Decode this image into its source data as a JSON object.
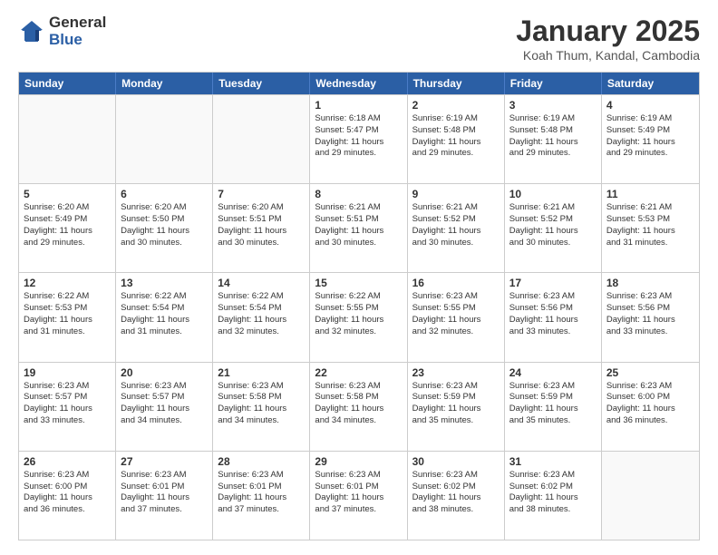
{
  "header": {
    "logo_general": "General",
    "logo_blue": "Blue",
    "month_title": "January 2025",
    "location": "Koah Thum, Kandal, Cambodia"
  },
  "days_of_week": [
    "Sunday",
    "Monday",
    "Tuesday",
    "Wednesday",
    "Thursday",
    "Friday",
    "Saturday"
  ],
  "weeks": [
    [
      {
        "day": "",
        "info": ""
      },
      {
        "day": "",
        "info": ""
      },
      {
        "day": "",
        "info": ""
      },
      {
        "day": "1",
        "info": "Sunrise: 6:18 AM\nSunset: 5:47 PM\nDaylight: 11 hours\nand 29 minutes."
      },
      {
        "day": "2",
        "info": "Sunrise: 6:19 AM\nSunset: 5:48 PM\nDaylight: 11 hours\nand 29 minutes."
      },
      {
        "day": "3",
        "info": "Sunrise: 6:19 AM\nSunset: 5:48 PM\nDaylight: 11 hours\nand 29 minutes."
      },
      {
        "day": "4",
        "info": "Sunrise: 6:19 AM\nSunset: 5:49 PM\nDaylight: 11 hours\nand 29 minutes."
      }
    ],
    [
      {
        "day": "5",
        "info": "Sunrise: 6:20 AM\nSunset: 5:49 PM\nDaylight: 11 hours\nand 29 minutes."
      },
      {
        "day": "6",
        "info": "Sunrise: 6:20 AM\nSunset: 5:50 PM\nDaylight: 11 hours\nand 30 minutes."
      },
      {
        "day": "7",
        "info": "Sunrise: 6:20 AM\nSunset: 5:51 PM\nDaylight: 11 hours\nand 30 minutes."
      },
      {
        "day": "8",
        "info": "Sunrise: 6:21 AM\nSunset: 5:51 PM\nDaylight: 11 hours\nand 30 minutes."
      },
      {
        "day": "9",
        "info": "Sunrise: 6:21 AM\nSunset: 5:52 PM\nDaylight: 11 hours\nand 30 minutes."
      },
      {
        "day": "10",
        "info": "Sunrise: 6:21 AM\nSunset: 5:52 PM\nDaylight: 11 hours\nand 30 minutes."
      },
      {
        "day": "11",
        "info": "Sunrise: 6:21 AM\nSunset: 5:53 PM\nDaylight: 11 hours\nand 31 minutes."
      }
    ],
    [
      {
        "day": "12",
        "info": "Sunrise: 6:22 AM\nSunset: 5:53 PM\nDaylight: 11 hours\nand 31 minutes."
      },
      {
        "day": "13",
        "info": "Sunrise: 6:22 AM\nSunset: 5:54 PM\nDaylight: 11 hours\nand 31 minutes."
      },
      {
        "day": "14",
        "info": "Sunrise: 6:22 AM\nSunset: 5:54 PM\nDaylight: 11 hours\nand 32 minutes."
      },
      {
        "day": "15",
        "info": "Sunrise: 6:22 AM\nSunset: 5:55 PM\nDaylight: 11 hours\nand 32 minutes."
      },
      {
        "day": "16",
        "info": "Sunrise: 6:23 AM\nSunset: 5:55 PM\nDaylight: 11 hours\nand 32 minutes."
      },
      {
        "day": "17",
        "info": "Sunrise: 6:23 AM\nSunset: 5:56 PM\nDaylight: 11 hours\nand 33 minutes."
      },
      {
        "day": "18",
        "info": "Sunrise: 6:23 AM\nSunset: 5:56 PM\nDaylight: 11 hours\nand 33 minutes."
      }
    ],
    [
      {
        "day": "19",
        "info": "Sunrise: 6:23 AM\nSunset: 5:57 PM\nDaylight: 11 hours\nand 33 minutes."
      },
      {
        "day": "20",
        "info": "Sunrise: 6:23 AM\nSunset: 5:57 PM\nDaylight: 11 hours\nand 34 minutes."
      },
      {
        "day": "21",
        "info": "Sunrise: 6:23 AM\nSunset: 5:58 PM\nDaylight: 11 hours\nand 34 minutes."
      },
      {
        "day": "22",
        "info": "Sunrise: 6:23 AM\nSunset: 5:58 PM\nDaylight: 11 hours\nand 34 minutes."
      },
      {
        "day": "23",
        "info": "Sunrise: 6:23 AM\nSunset: 5:59 PM\nDaylight: 11 hours\nand 35 minutes."
      },
      {
        "day": "24",
        "info": "Sunrise: 6:23 AM\nSunset: 5:59 PM\nDaylight: 11 hours\nand 35 minutes."
      },
      {
        "day": "25",
        "info": "Sunrise: 6:23 AM\nSunset: 6:00 PM\nDaylight: 11 hours\nand 36 minutes."
      }
    ],
    [
      {
        "day": "26",
        "info": "Sunrise: 6:23 AM\nSunset: 6:00 PM\nDaylight: 11 hours\nand 36 minutes."
      },
      {
        "day": "27",
        "info": "Sunrise: 6:23 AM\nSunset: 6:01 PM\nDaylight: 11 hours\nand 37 minutes."
      },
      {
        "day": "28",
        "info": "Sunrise: 6:23 AM\nSunset: 6:01 PM\nDaylight: 11 hours\nand 37 minutes."
      },
      {
        "day": "29",
        "info": "Sunrise: 6:23 AM\nSunset: 6:01 PM\nDaylight: 11 hours\nand 37 minutes."
      },
      {
        "day": "30",
        "info": "Sunrise: 6:23 AM\nSunset: 6:02 PM\nDaylight: 11 hours\nand 38 minutes."
      },
      {
        "day": "31",
        "info": "Sunrise: 6:23 AM\nSunset: 6:02 PM\nDaylight: 11 hours\nand 38 minutes."
      },
      {
        "day": "",
        "info": ""
      }
    ]
  ]
}
